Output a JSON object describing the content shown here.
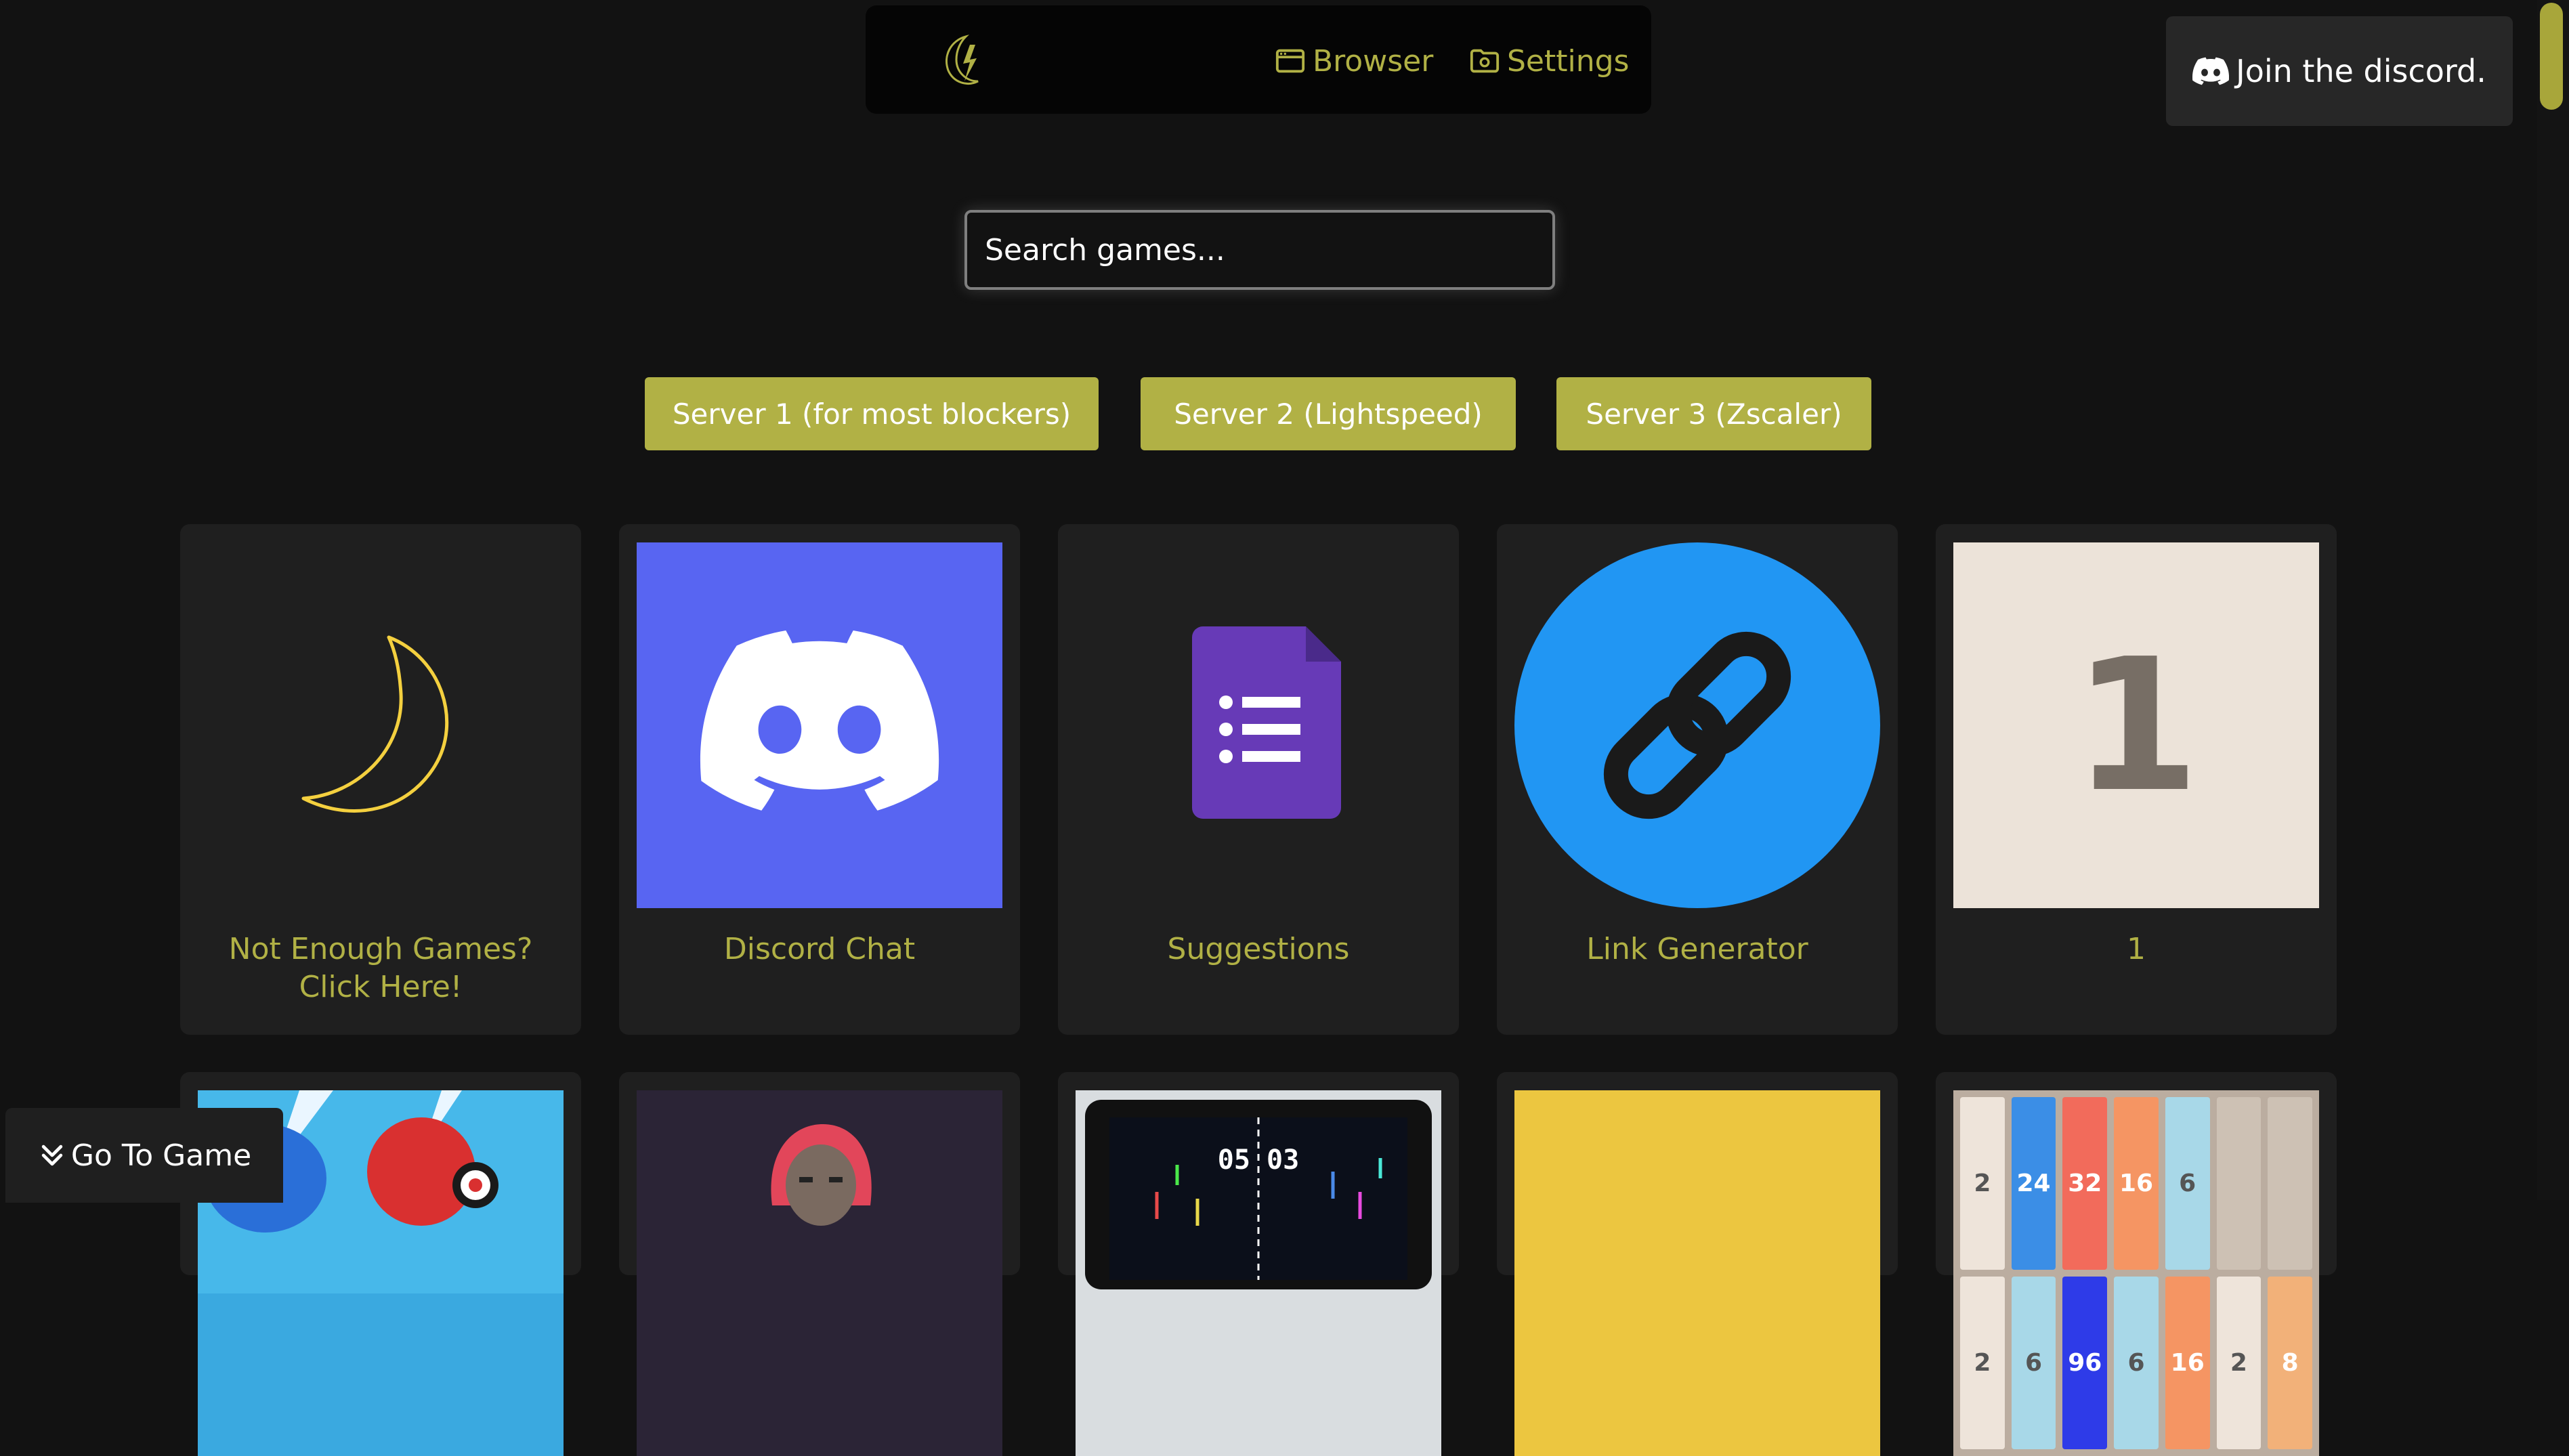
{
  "nav": {
    "logo_icon": "moon-bolt-logo-icon",
    "browser_label": "Browser",
    "browser_icon": "browser-window-icon",
    "settings_label": "Settings",
    "settings_icon": "folder-gear-icon"
  },
  "discord_button": {
    "label": "Join the discord.",
    "icon": "discord-icon"
  },
  "search": {
    "placeholder": "Search games..."
  },
  "servers": [
    {
      "label": "Server 1 (for most blockers)"
    },
    {
      "label": "Server 2 (Lightspeed)"
    },
    {
      "label": "Server 3 (Zscaler)"
    }
  ],
  "games": [
    {
      "title": "Not Enough Games? Click Here!",
      "icon": "moon-icon"
    },
    {
      "title": "Discord Chat",
      "icon": "discord-icon"
    },
    {
      "title": "Suggestions",
      "icon": "google-forms-icon"
    },
    {
      "title": "Link Generator",
      "icon": "link-icon"
    },
    {
      "title": "1",
      "thumb_text": "1"
    }
  ],
  "row2_tiles": {
    "row_a": [
      "2",
      "24",
      "32",
      "16",
      "6",
      "",
      ""
    ],
    "row_b": [
      "2",
      "6",
      "96",
      "6",
      "16",
      "2",
      "8"
    ]
  },
  "pong_score": "05 03",
  "goto_button": {
    "label": "Go To Game",
    "icon": "double-chevron-down-icon"
  },
  "colors": {
    "accent": "#b1b145",
    "background": "#121212",
    "card": "#1f1f1f",
    "discord_blue": "#5865f2",
    "link_blue": "#2196f3",
    "forms_purple": "#673ab7",
    "moon_yellow": "#f4d03f"
  }
}
